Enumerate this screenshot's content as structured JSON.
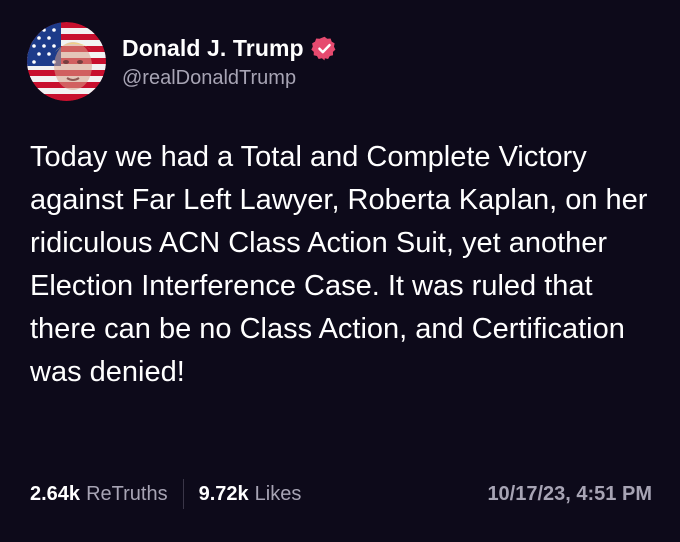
{
  "author": {
    "display_name": "Donald J. Trump",
    "handle": "@realDonaldTrump",
    "verified": true,
    "avatar_icon": "flag-portrait-avatar",
    "verified_icon": "verified-badge-icon",
    "verified_color": "#e64a6f"
  },
  "post": {
    "text": "Today we had a Total and Complete Victory against Far Left Lawyer, Roberta Kaplan, on her ridiculous ACN Class Action Suit, yet another Election Interference Case. It was ruled that there can be no Class Action, and Certification was denied!"
  },
  "stats": {
    "retruths_count": "2.64k",
    "retruths_label": "ReTruths",
    "likes_count": "9.72k",
    "likes_label": "Likes"
  },
  "timestamp": "10/17/23, 4:51 PM",
  "colors": {
    "background": "#0d0a1a",
    "text": "#ffffff",
    "muted": "#a7a4b4"
  }
}
